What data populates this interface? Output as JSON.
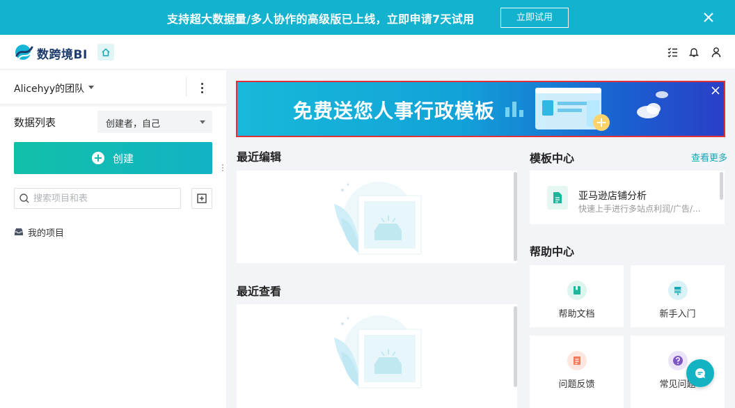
{
  "promo": {
    "message": "支持超大数据量/多人协作的高级版已上线，立即申请7天试用",
    "cta_label": "立即试用"
  },
  "header": {
    "app_name": "数跨境BI"
  },
  "sidebar": {
    "team_name": "Alicehyy的团队",
    "list_title": "数据列表",
    "creator_filter": "创建者，自己",
    "create_label": "创建",
    "search_placeholder": "搜索项目和表",
    "projects": [
      "我的项目"
    ]
  },
  "banner": {
    "text": "免费送您人事行政模板"
  },
  "recent_edit": {
    "title": "最近编辑"
  },
  "recent_view": {
    "title": "最近查看"
  },
  "template_center": {
    "title": "模板中心",
    "more_label": "查看更多",
    "items": [
      {
        "name": "亚马逊店铺分析",
        "desc": "快速上手进行多站点利润/广告/..."
      }
    ]
  },
  "help_center": {
    "title": "帮助中心",
    "items": [
      {
        "label": "帮助文档",
        "icon": "document-icon"
      },
      {
        "label": "新手入门",
        "icon": "guide-sign-icon"
      },
      {
        "label": "问题反馈",
        "icon": "feedback-icon"
      },
      {
        "label": "常见问题",
        "icon": "question-icon"
      }
    ]
  },
  "colors": {
    "promo_bg": "#13b2cf",
    "accent": "#13b9b5",
    "banner_border": "#e0313a"
  }
}
